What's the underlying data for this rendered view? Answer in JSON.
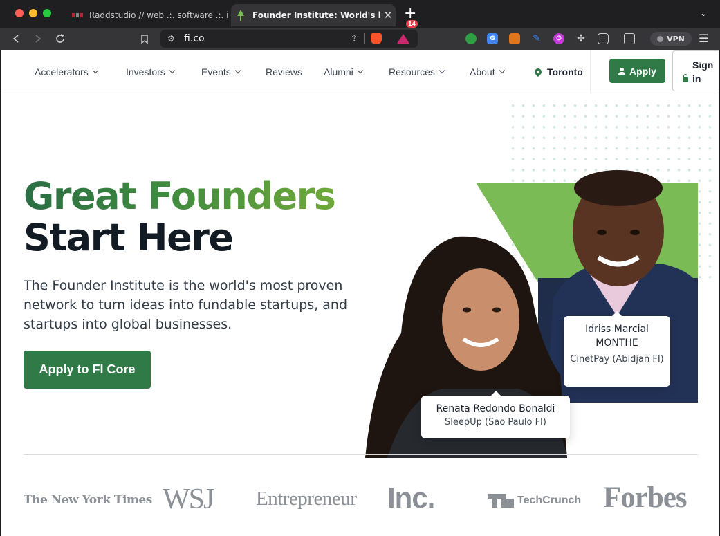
{
  "browser": {
    "tabs": [
      {
        "title": "Raddstudio // web .:. software .:. ide",
        "active": false
      },
      {
        "title": "Founder Institute: World's largest pre-seed startup accelerator",
        "active": true
      }
    ],
    "url": "fi.co",
    "rewards_badge": "14",
    "vpn_label": "VPN",
    "colors": {
      "tabbar": "#1f1f21",
      "toolbar": "#353538"
    }
  },
  "nav": {
    "items": [
      {
        "label": "Accelerators",
        "dropdown": true
      },
      {
        "label": "Investors",
        "dropdown": true
      },
      {
        "label": "Events",
        "dropdown": true
      },
      {
        "label": "Reviews",
        "dropdown": false
      },
      {
        "label": "Alumni",
        "dropdown": true
      },
      {
        "label": "Resources",
        "dropdown": true
      },
      {
        "label": "About",
        "dropdown": true
      }
    ],
    "location": "Toronto",
    "apply_label": "Apply",
    "signin_label": "Sign in"
  },
  "hero": {
    "title_line1": "Great Founders",
    "title_line2": "Start Here",
    "subtitle": "The Founder Institute is the world's most proven network to turn ideas into fundable startups, and startups into global businesses.",
    "cta_label": "Apply to FI Core",
    "founders": [
      {
        "name": "Idriss Marcial MONTHE",
        "company": "CinetPay (Abidjan FI)"
      },
      {
        "name": "Renata Redondo Bonaldi",
        "company": "SleepUp (Sao Paulo FI)"
      }
    ],
    "colors": {
      "brand_green": "#2f7a47",
      "accent_green": "#7bbb55"
    }
  },
  "press": {
    "logos": [
      {
        "name": "nyt-logo",
        "text": "The New York Times"
      },
      {
        "name": "wsj-logo",
        "text": "WSJ"
      },
      {
        "name": "entrepreneur-logo",
        "text": "Entrepreneur"
      },
      {
        "name": "inc-logo",
        "text": "Inc."
      },
      {
        "name": "techcrunch-logo",
        "text": "TechCrunch"
      },
      {
        "name": "forbes-logo",
        "text": "Forbes"
      }
    ]
  }
}
